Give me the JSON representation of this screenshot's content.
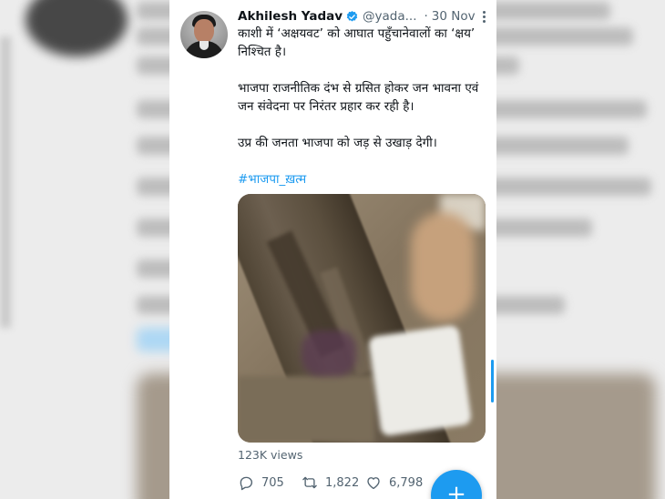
{
  "tweet": {
    "author_name": "Akhilesh Yadav",
    "handle": "@yada...",
    "dot": "·",
    "date": "30 Nov",
    "paragraphs": [
      "काशी में ‘अक्षयवट’ को आघात पहुँचानेवालों का ‘क्षय’ निश्चित है।",
      "भाजपा राजनीतिक दंभ से ग्रसित होकर जन भावना एवं जन संवेदना पर निरंतर प्रहार कर रही है।",
      "उप्र की जनता भाजपा को जड़ से उखाड़ देगी।"
    ],
    "hashtag": "#भाजपा_ख़त्म",
    "views": "123K views",
    "replies": "705",
    "retweets": "1,822",
    "likes": "6,798"
  },
  "compose_button": {
    "label": "+"
  },
  "icons": {
    "verified": "verified-badge-icon",
    "more": "more-options-icon",
    "reply": "reply-icon",
    "retweet": "retweet-icon",
    "like": "heart-icon",
    "compose": "plus-icon"
  },
  "colors": {
    "accent": "#1d9bf0",
    "text_primary": "#0f1419",
    "text_secondary": "#536471",
    "card_background": "#ffffff"
  }
}
